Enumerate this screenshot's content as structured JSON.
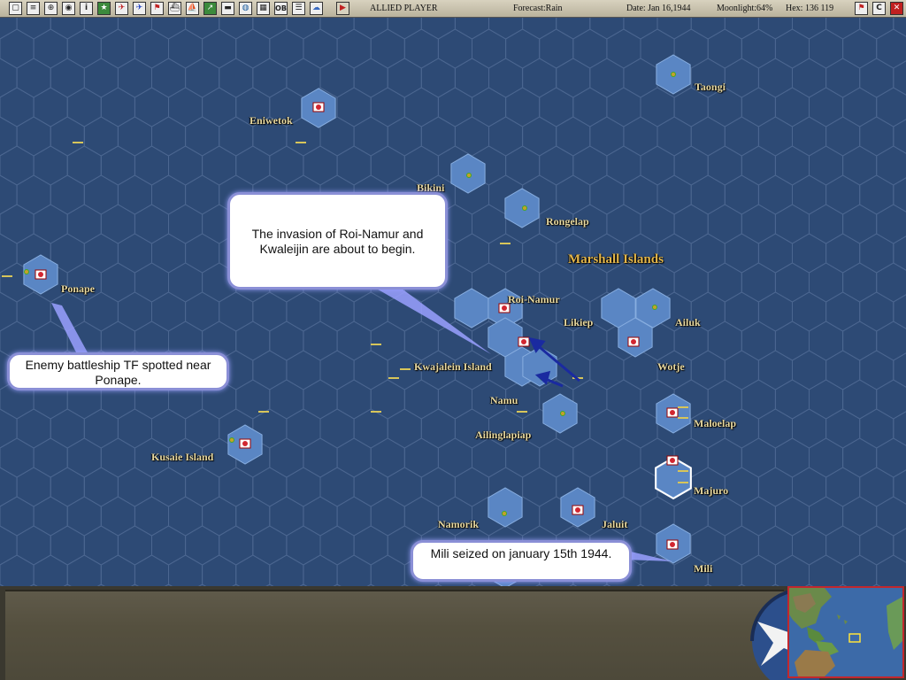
{
  "toolbar": {
    "buttons": [
      "square-icon",
      "doc-icon",
      "zoom-icon",
      "globe-icon",
      "info-icon",
      "star-icon",
      "plane-red-icon",
      "plane-blue-icon",
      "flag-icon",
      "ship-icon",
      "ship-alt-icon",
      "graph-icon",
      "carrier-icon",
      "globe-alt-icon",
      "ground-icon",
      "ob-icon",
      "list-icon",
      "cloud-icon",
      "play-icon"
    ],
    "ob_label": "OB",
    "info_label": "i",
    "player": "ALLIED PLAYER",
    "forecast": "Forecast:Rain",
    "date": "Date: Jan 16,1944",
    "moonlight": "Moonlight:64%",
    "hex": "Hex: 136 119",
    "right_buttons": [
      "flag-exit-icon",
      "c-icon",
      "close-icon"
    ],
    "c_label": "C"
  },
  "map": {
    "labels": {
      "taongi": "Taongi",
      "eniwetok": "Eniwetok",
      "bikini": "Bikini",
      "rongelap": "Rongelap",
      "marshall": "Marshall Islands",
      "ponape": "Ponape",
      "roi": "Roi-Namur",
      "likiep": "Likiep",
      "ailuk": "Ailuk",
      "wotje": "Wotje",
      "kwaj": "Kwajalein Island",
      "namu": "Namu",
      "ailing": "Ailinglapiap",
      "maloelap": "Maloelap",
      "kusaie": "Kusaie Island",
      "majuro": "Majuro",
      "namorik": "Namorik",
      "jaluit": "Jaluit",
      "mili": "Mili"
    },
    "callouts": {
      "invasion": "The invasion of Roi-Namur and Kwaleijin are about to begin.",
      "ponape": "Enemy battleship TF spotted near Ponape.",
      "mili": "Mili seized on january 15th 1944."
    },
    "colors": {
      "ocean": "#2d4a75",
      "island_hex": "#5a86c4",
      "japanese_flag": "#d22630",
      "allied_unit": "#d7c55a"
    }
  }
}
